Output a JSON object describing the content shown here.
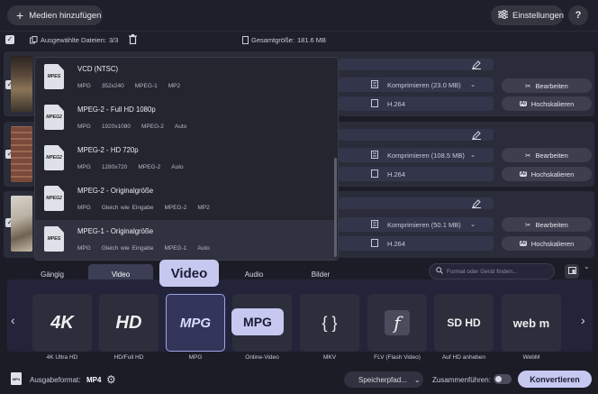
{
  "toolbar": {
    "add_label": "Medien hinzufügen",
    "settings_label": "Einstellungen",
    "help_label": "?"
  },
  "selection": {
    "label": "Ausgewählte Dateien:",
    "count": "3/3",
    "total_label": "Gesamtgröße:",
    "total_value": "181.6 MB"
  },
  "files": [
    {
      "compress": "Komprimieren (23.0 MB)",
      "codec": "H.264",
      "edit": "Bearbeiten",
      "upscale": "Hochskalieren"
    },
    {
      "compress": "Komprimieren (108.5 MB)",
      "codec": "H.264",
      "edit": "Bearbeiten",
      "upscale": "Hochskalieren"
    },
    {
      "compress": "Komprimieren (50.1 MB)",
      "codec": "H.264",
      "edit": "Bearbeiten",
      "upscale": "Hochskalieren"
    }
  ],
  "presets": [
    {
      "icon": "MPEG",
      "name": "VCD (NTSC)",
      "specs": [
        "MPG",
        "352x240",
        "MPEG-1",
        "MP2"
      ]
    },
    {
      "icon": "MPEG2",
      "name": "MPEG-2 - Full HD 1080p",
      "specs": [
        "MPG",
        "1920x1080",
        "MPEG-2",
        "Auto"
      ]
    },
    {
      "icon": "MPEG2",
      "name": "MPEG-2 - HD 720p",
      "specs": [
        "MPG",
        "1280x720",
        "MPEG-2",
        "Auto"
      ]
    },
    {
      "icon": "MPEG2",
      "name": "MPEG-2  - Originalgröße",
      "specs": [
        "MPG",
        "Gleich wie Eingabe",
        "MPEG-2",
        "MP2"
      ]
    },
    {
      "icon": "MPEG",
      "name": "MPEG-1  - Originalgröße",
      "specs": [
        "MPG",
        "Gleich wie Eingabe",
        "MPEG-1",
        "Auto"
      ]
    }
  ],
  "tabs": [
    "Gängig",
    "Video",
    "Audio",
    "Bilder"
  ],
  "search": {
    "placeholder": "Format oder Gerät finden..."
  },
  "formats": [
    {
      "label": "4K Ultra HD",
      "icon": "4K"
    },
    {
      "label": "HD/Full HD",
      "icon": "HD"
    },
    {
      "label": "MPG",
      "icon": "MPG"
    },
    {
      "label": "Online-Video",
      "icon": ""
    },
    {
      "label": "MKV",
      "icon": "{ }"
    },
    {
      "label": "FLV (Flash Video)",
      "icon": "f"
    },
    {
      "label": "Auf HD anheben",
      "icon": "SD HD"
    },
    {
      "label": "WebM",
      "icon": "web m"
    }
  ],
  "callouts": {
    "video": "Video",
    "mpg": "MPG"
  },
  "footer": {
    "output_label": "Ausgabeformat:",
    "output_value": "MP4",
    "save_label": "Speicherpfad...",
    "merge_label": "Zusammenführen:",
    "convert_label": "Konvertieren"
  },
  "colors": {
    "accent": "#c6c8f0",
    "background": "#1c1d27",
    "card": "#2a2c39"
  }
}
